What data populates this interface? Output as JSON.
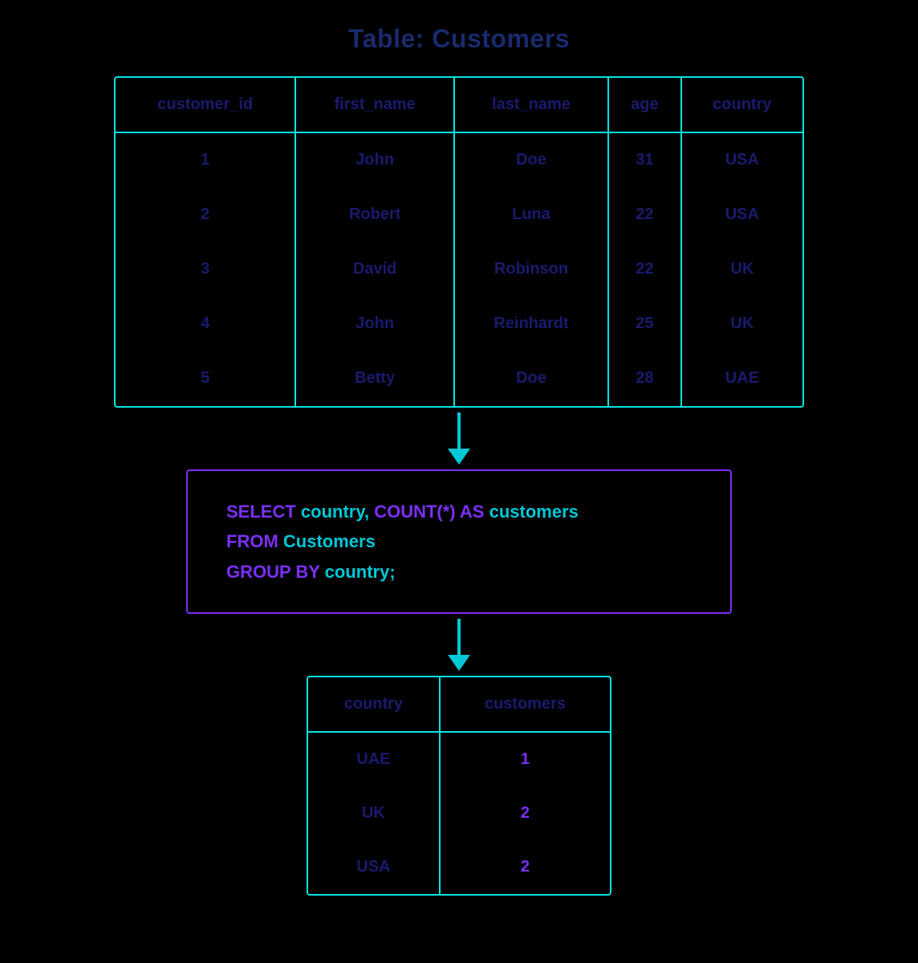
{
  "page": {
    "title": "Table: Customers",
    "background": "#000000"
  },
  "top_table": {
    "columns": [
      "customer_id",
      "first_name",
      "last_name",
      "age",
      "country"
    ],
    "rows": [
      {
        "customer_id": "1",
        "first_name": "John",
        "last_name": "Doe",
        "age": "31",
        "country": "USA"
      },
      {
        "customer_id": "2",
        "first_name": "Robert",
        "last_name": "Luna",
        "age": "22",
        "country": "USA"
      },
      {
        "customer_id": "3",
        "first_name": "David",
        "last_name": "Robinson",
        "age": "22",
        "country": "UK"
      },
      {
        "customer_id": "4",
        "first_name": "John",
        "last_name": "Reinhardt",
        "age": "25",
        "country": "UK"
      },
      {
        "customer_id": "5",
        "first_name": "Betty",
        "last_name": "Doe",
        "age": "28",
        "country": "UAE"
      }
    ]
  },
  "sql": {
    "line1_kw": "SELECT",
    "line1_plain": " country, ",
    "line1_kw2": "COUNT(*) AS",
    "line1_plain2": " customers",
    "line2_kw": "FROM",
    "line2_plain": " Customers",
    "line3_kw": "GROUP BY",
    "line3_plain": " country;"
  },
  "result_table": {
    "columns": [
      "country",
      "customers"
    ],
    "rows": [
      {
        "country": "UAE",
        "customers": "1"
      },
      {
        "country": "UK",
        "customers": "2"
      },
      {
        "country": "USA",
        "customers": "2"
      }
    ]
  }
}
